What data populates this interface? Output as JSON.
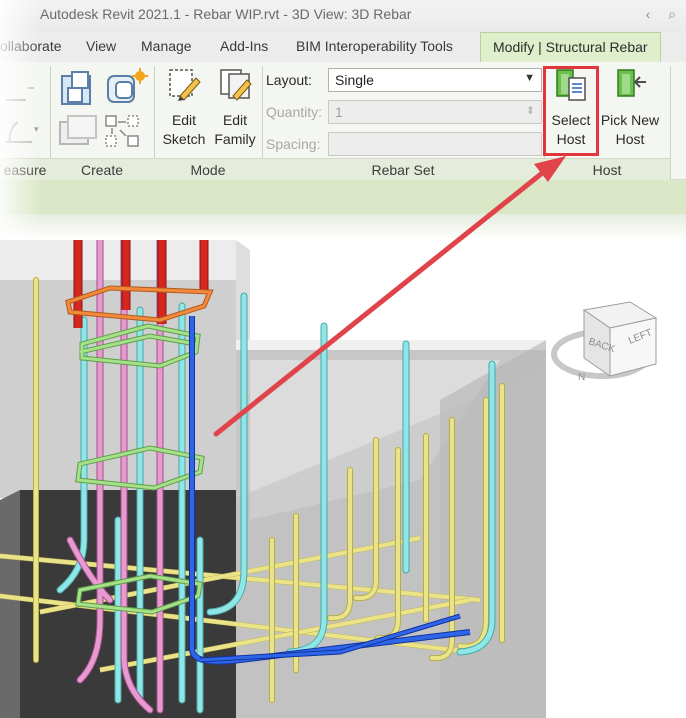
{
  "app": {
    "title": "Autodesk Revit 2021.1 - Rebar WIP.rvt - 3D View: 3D Rebar"
  },
  "tabs": [
    {
      "label": "ollaborate"
    },
    {
      "label": "View"
    },
    {
      "label": "Manage"
    },
    {
      "label": "Add-Ins"
    },
    {
      "label": "BIM Interoperability Tools"
    },
    {
      "label": "Modify | Structural Rebar",
      "active": true
    }
  ],
  "panels": {
    "measure_label": "easure",
    "create_label": "Create",
    "mode_label": "Mode",
    "rebar_set_label": "Rebar Set",
    "host_label": "Host"
  },
  "mode_buttons": [
    {
      "line1": "Edit",
      "line2": "Sketch",
      "icon": "edit-sketch-icon"
    },
    {
      "line1": "Edit",
      "line2": "Family",
      "icon": "edit-family-icon"
    }
  ],
  "rebar_set": {
    "layout_label": "Layout:",
    "layout_value": "Single",
    "quantity_label": "Quantity:",
    "quantity_value": "1",
    "spacing_label": "Spacing:",
    "spacing_value": ""
  },
  "host_buttons": [
    {
      "line1": "Select",
      "line2": "Host",
      "icon": "select-host-icon",
      "highlighted": true
    },
    {
      "line1": "Pick New",
      "line2": "Host",
      "icon": "pick-new-host-icon"
    }
  ],
  "viewcube": {
    "face_back": "BACK",
    "face_left": "LEFT",
    "compass_n": "N"
  },
  "colors": {
    "highlight": "#e0363c",
    "active_tab": "#dfeecb",
    "rebar_cyan": "#8ee6e6",
    "rebar_pink": "#e89ad0",
    "rebar_red": "#d5261f",
    "rebar_yellow": "#eae38a",
    "rebar_green": "#a6e08a",
    "rebar_blue": "#2353d6",
    "rebar_orange": "#f28a3b"
  }
}
